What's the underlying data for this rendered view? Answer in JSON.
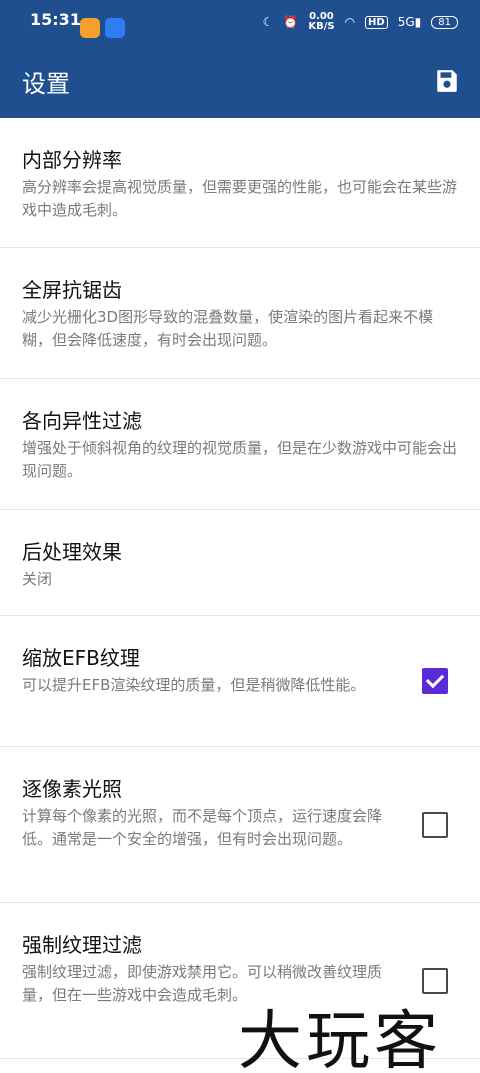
{
  "status_bar": {
    "time": "15:31",
    "speed_value": "0.00",
    "speed_unit": "KB/S",
    "hd_badge": "HD",
    "signal_label": "5G",
    "battery": "81"
  },
  "app_bar": {
    "title": "设置",
    "save_icon": "save-icon"
  },
  "settings": [
    {
      "title": "内部分辨率",
      "description": "高分辨率会提高视觉质量，但需要更强的性能，也可能会在某些游戏中造成毛刺。"
    },
    {
      "title": "全屏抗锯齿",
      "description": "减少光栅化3D图形导致的混叠数量，使渲染的图片看起来不模糊，但会降低速度，有时会出现问题。"
    },
    {
      "title": "各向异性过滤",
      "description": "增强处于倾斜视角的纹理的视觉质量，但是在少数游戏中可能会出现问题。"
    },
    {
      "title": "后处理效果",
      "description": "关闭"
    },
    {
      "title": "缩放EFB纹理",
      "description": "可以提升EFB渲染纹理的质量，但是稍微降低性能。",
      "checked": true
    },
    {
      "title": "逐像素光照",
      "description": "计算每个像素的光照，而不是每个顶点，运行速度会降低。通常是一个安全的增强，但有时会出现问题。",
      "checked": false
    },
    {
      "title": "强制纹理过滤",
      "description": "强制纹理过滤，即使游戏禁用它。可以稍微改善纹理质量，但在一些游戏中会造成毛刺。",
      "checked": false
    }
  ],
  "watermark": "大玩客",
  "colors": {
    "app_bar": "#1f4f8f",
    "checkbox_checked": "#5a2ad6"
  }
}
